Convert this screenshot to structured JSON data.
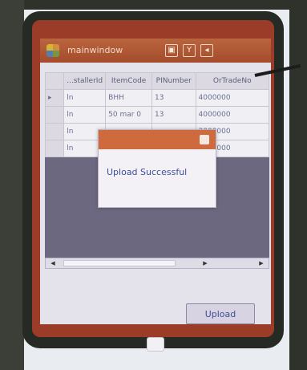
{
  "window": {
    "title": "mainwindow"
  },
  "grid": {
    "columns": [
      "...stallerId",
      "ItemCode",
      "PINumber",
      "OrTradeNo"
    ],
    "rows": [
      {
        "marker": "▸",
        "cells": [
          "ln",
          "BHH",
          "13",
          "4000000"
        ]
      },
      {
        "marker": "",
        "cells": [
          "ln",
          "50 mar 0",
          "13",
          "4000000"
        ]
      },
      {
        "marker": "",
        "cells": [
          "ln",
          "",
          "",
          "3000000"
        ]
      },
      {
        "marker": "",
        "cells": [
          "ln",
          "",
          "",
          "4000000"
        ]
      }
    ]
  },
  "dialog": {
    "message": "Upload Successful"
  },
  "actions": {
    "upload_label": "Upload"
  },
  "colors": {
    "titlebar": "#a44c2c",
    "dialog_title": "#cf6a3e",
    "text_blue": "#3d4f9a"
  },
  "icons": {
    "start": "windows-flag-icon",
    "dialog": "ok-icon",
    "home": "keyboard-icon"
  }
}
